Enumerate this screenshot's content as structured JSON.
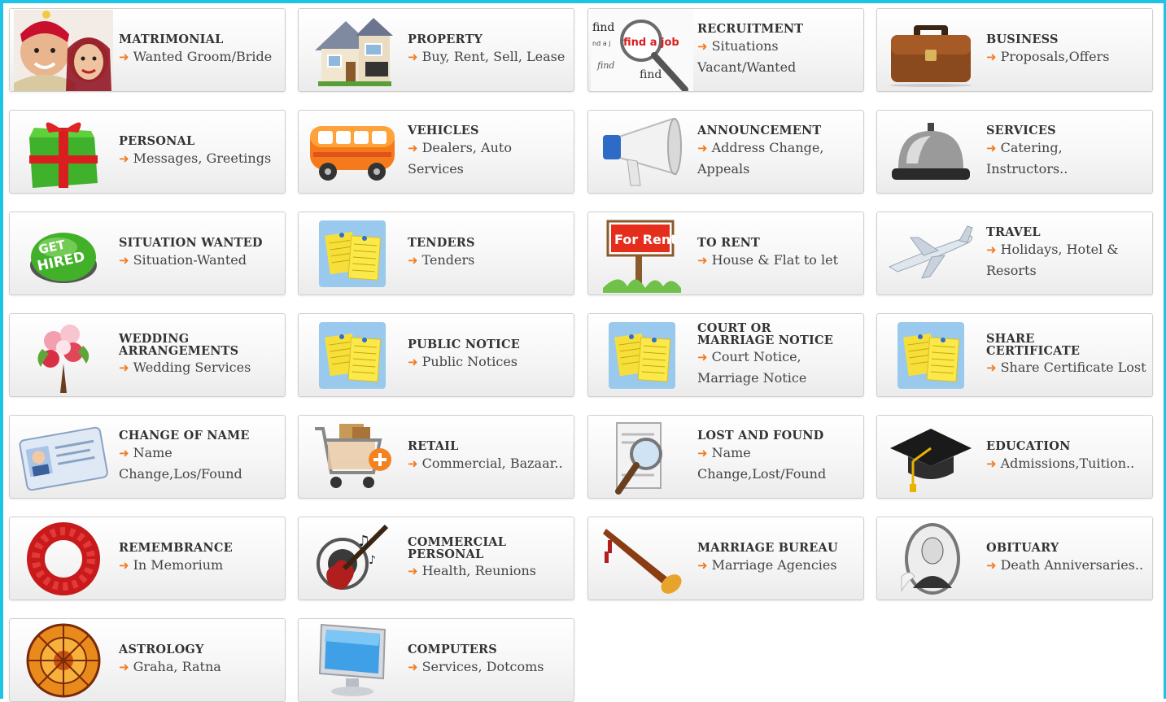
{
  "colors": {
    "frame": "#1ec3e6",
    "arrow": "#f47a20",
    "title": "#333333",
    "text": "#444444"
  },
  "arrow_glyph": "➜",
  "categories": [
    {
      "id": "matrimonial",
      "title": "MATRIMONIAL",
      "desc": "Wanted Groom/Bride",
      "icon": "bride-groom-icon"
    },
    {
      "id": "property",
      "title": "PROPERTY",
      "desc": "Buy, Rent, Sell, Lease",
      "icon": "house-icon"
    },
    {
      "id": "recruitment",
      "title": "RECRUITMENT",
      "desc": "Situations Vacant/Wanted",
      "icon": "find-a-job-icon",
      "icon_text": "find a job"
    },
    {
      "id": "business",
      "title": "BUSINESS",
      "desc": "Proposals,Offers",
      "icon": "briefcase-icon"
    },
    {
      "id": "personal",
      "title": "PERSONAL",
      "desc": "Messages, Greetings",
      "icon": "gift-icon"
    },
    {
      "id": "vehicles",
      "title": "VEHICLES",
      "desc": "Dealers, Auto Services",
      "icon": "bus-icon"
    },
    {
      "id": "announcement",
      "title": "ANNOUNCEMENT",
      "desc": "Address Change, Appeals",
      "icon": "megaphone-icon"
    },
    {
      "id": "services",
      "title": "SERVICES",
      "desc": "Catering, Instructors..",
      "icon": "service-bell-icon"
    },
    {
      "id": "situation-wanted",
      "title": "SITUATION WANTED",
      "desc": "Situation-Wanted",
      "icon": "get-hired-button-icon",
      "icon_text": "GET HIRED"
    },
    {
      "id": "tenders",
      "title": "TENDERS",
      "desc": "Tenders",
      "icon": "notes-icon"
    },
    {
      "id": "to-rent",
      "title": "TO RENT",
      "desc": "House & Flat to let",
      "icon": "for-rent-sign-icon",
      "icon_text": "For Rent"
    },
    {
      "id": "travel",
      "title": "TRAVEL",
      "desc": "Holidays, Hotel & Resorts",
      "icon": "airplane-icon"
    },
    {
      "id": "wedding-arrangements",
      "title": "WEDDING ARRANGEMENTS",
      "desc": "Wedding Services",
      "icon": "flower-bouquet-icon"
    },
    {
      "id": "public-notice",
      "title": "PUBLIC NOTICE",
      "desc": "Public Notices",
      "icon": "notes-icon"
    },
    {
      "id": "court-or-marriage-notice",
      "title": "COURT OR MARRIAGE NOTICE",
      "desc": "Court Notice, Marriage Notice",
      "icon": "notes-icon"
    },
    {
      "id": "share-certificate",
      "title": "SHARE CERTIFICATE",
      "desc": "Share Certificate Lost",
      "icon": "notes-icon"
    },
    {
      "id": "change-of-name",
      "title": "CHANGE OF NAME",
      "desc": "Name Change,Los/Found",
      "icon": "id-card-icon"
    },
    {
      "id": "retail",
      "title": "RETAIL",
      "desc": "Commercial, Bazaar..",
      "icon": "shopping-cart-icon"
    },
    {
      "id": "lost-and-found",
      "title": "LOST AND FOUND",
      "desc": "Name Change,Lost/Found",
      "icon": "magnifier-document-icon"
    },
    {
      "id": "education",
      "title": "EDUCATION",
      "desc": "Admissions,Tuition..",
      "icon": "graduation-cap-icon"
    },
    {
      "id": "remembrance",
      "title": "REMEMBRANCE",
      "desc": "In Memorium",
      "icon": "flower-wreath-icon"
    },
    {
      "id": "commercial-personal",
      "title": "COMMERCIAL PERSONAL",
      "desc": "Health, Reunions",
      "icon": "guitar-music-icon"
    },
    {
      "id": "marriage-bureau",
      "title": "MARRIAGE BUREAU",
      "desc": "Marriage Agencies",
      "icon": "shehnai-horn-icon"
    },
    {
      "id": "obituary",
      "title": "OBITUARY",
      "desc": "Death Anniversaries..",
      "icon": "portrait-frame-icon"
    },
    {
      "id": "astrology",
      "title": "ASTROLOGY",
      "desc": "Graha, Ratna",
      "icon": "zodiac-wheel-icon"
    },
    {
      "id": "computers",
      "title": "COMPUTERS",
      "desc": "Services, Dotcoms",
      "icon": "computer-monitor-icon"
    }
  ]
}
